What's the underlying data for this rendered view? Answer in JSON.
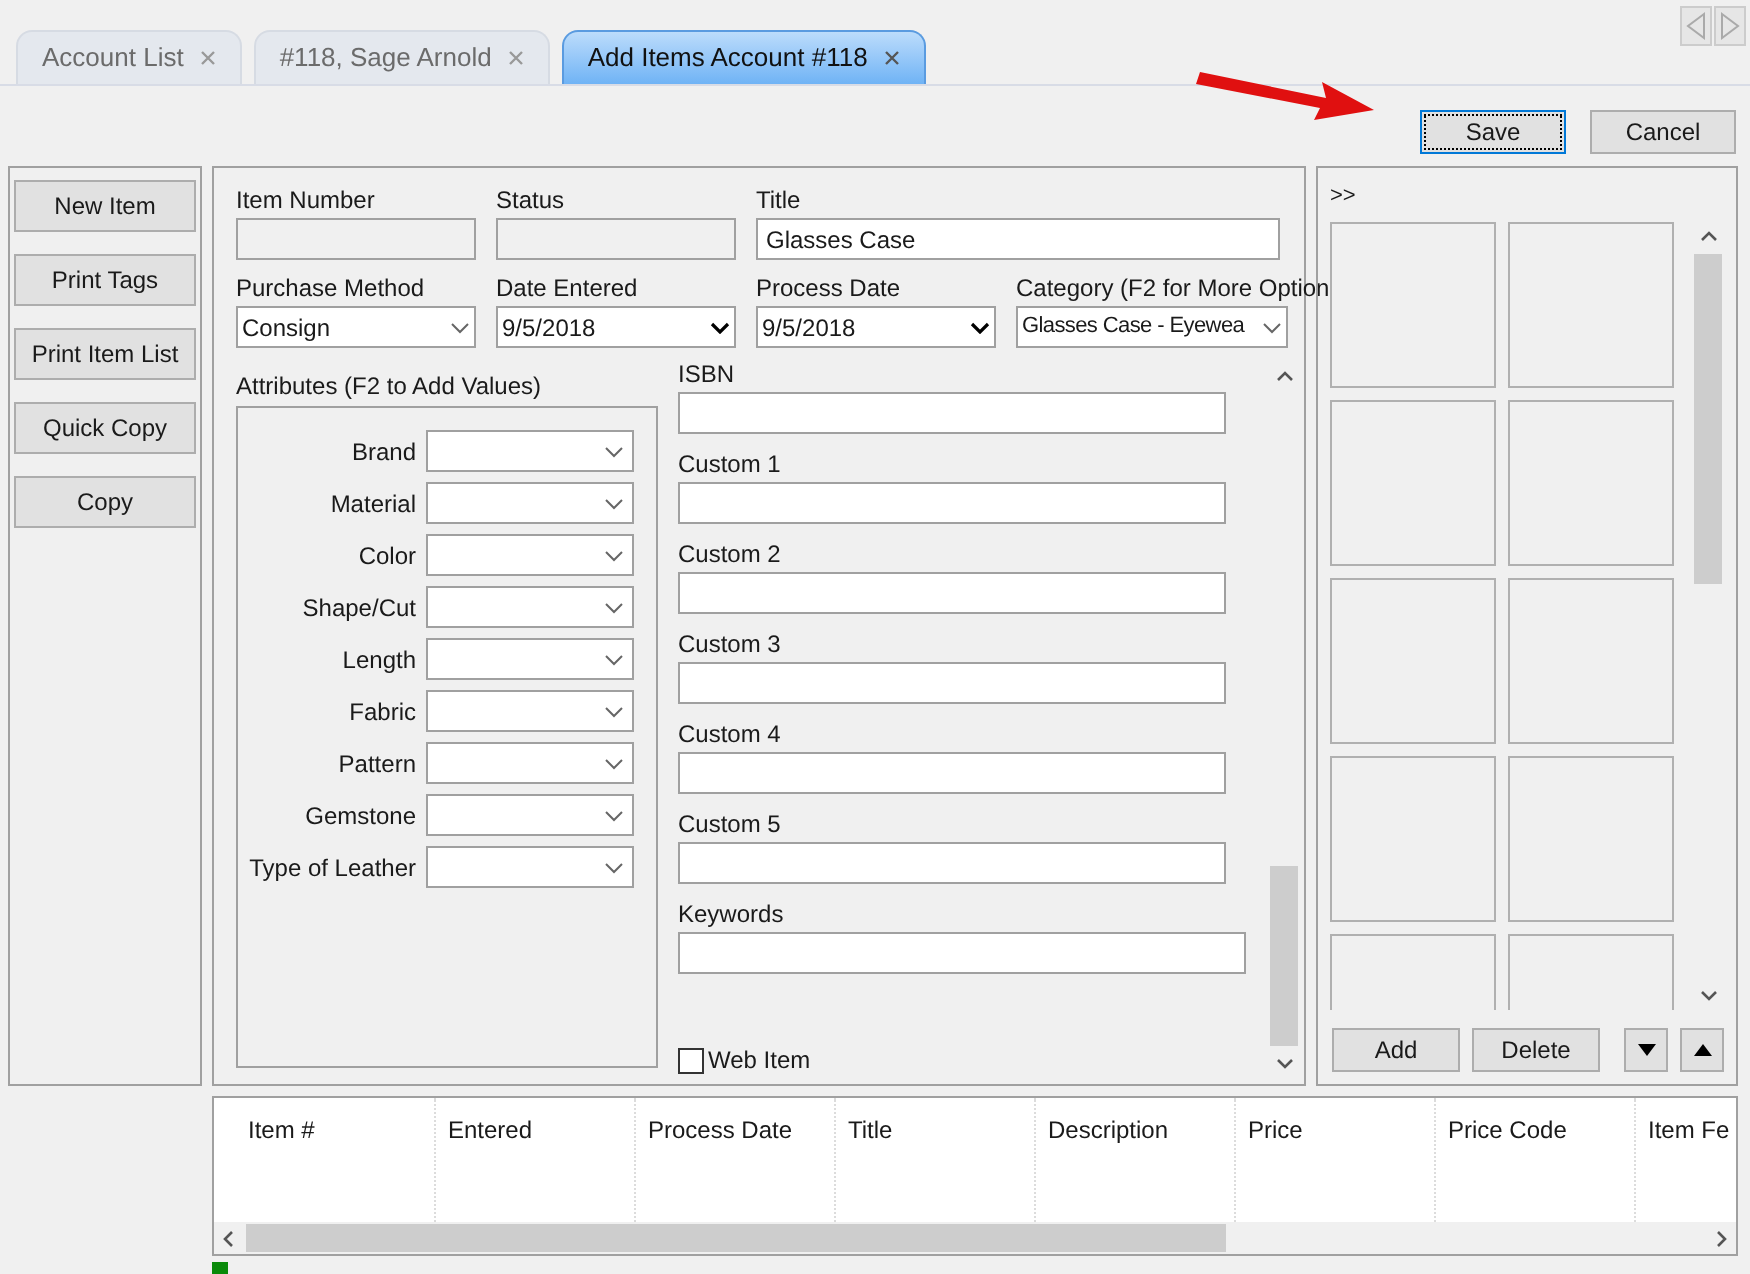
{
  "tabs": [
    {
      "label": "Account List",
      "selected": false
    },
    {
      "label": "#118, Sage Arnold",
      "selected": false
    },
    {
      "label": "Add Items Account #118",
      "selected": true
    }
  ],
  "actions": [
    {
      "label": "Save",
      "focused": true
    },
    {
      "label": "Cancel",
      "focused": false
    }
  ],
  "side_buttons": [
    "New Item",
    "Print Tags",
    "Print Item List",
    "Quick Copy",
    "Copy"
  ],
  "form_rows": [
    [
      {
        "label": "Item Number",
        "kind": "text",
        "disabled": true
      },
      {
        "label": "Status",
        "kind": "text",
        "disabled": true
      },
      {
        "label": "Title",
        "kind": "text",
        "disabled": false,
        "value": "Glasses Case"
      }
    ],
    [
      {
        "label": "Purchase Method",
        "kind": "select",
        "disabled": false,
        "value": "Consign"
      },
      {
        "label": "Date Entered",
        "kind": "date",
        "disabled": false,
        "value": "9/5/2018"
      },
      {
        "label": "Process Date",
        "kind": "date",
        "disabled": false,
        "value": "9/5/2018"
      },
      {
        "label": "Category (F2 for More Option",
        "kind": "select",
        "disabled": false,
        "value": "Glasses Case - Eyewea"
      }
    ]
  ],
  "attributes": {
    "title": "Attributes (F2 to Add Values)",
    "items": [
      "Brand",
      "Material",
      "Color",
      "Shape/Cut",
      "Length",
      "Fabric",
      "Pattern",
      "Gemstone",
      "Type of Leather"
    ]
  },
  "custom_fields": [
    "ISBN",
    "Custom 1",
    "Custom 2",
    "Custom 3",
    "Custom 4",
    "Custom 5"
  ],
  "keywords": {
    "label": "Keywords"
  },
  "web_item": {
    "label": "Web Item",
    "checked": false
  },
  "photo_panel": {
    "toggle": ">>",
    "buttons": [
      "Add",
      "Delete"
    ]
  },
  "table": {
    "columns": [
      "Item #",
      "Entered",
      "Process Date",
      "Title",
      "Description",
      "Price",
      "Price Code",
      "Item Fe"
    ]
  }
}
